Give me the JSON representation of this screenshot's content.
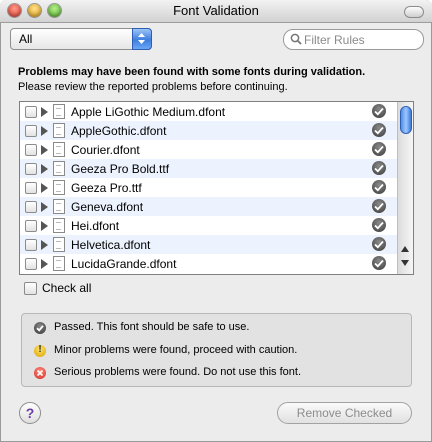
{
  "window": {
    "title": "Font Validation"
  },
  "filter": {
    "selected": "All"
  },
  "search": {
    "placeholder": "Filter Rules"
  },
  "message": {
    "headline": "Problems may have been found with some fonts during validation.",
    "subline": "Please review the reported problems before continuing."
  },
  "fonts": [
    {
      "name": "Apple LiGothic Medium.dfont",
      "status": "passed",
      "checked": false
    },
    {
      "name": "AppleGothic.dfont",
      "status": "passed",
      "checked": false
    },
    {
      "name": "Courier.dfont",
      "status": "passed",
      "checked": false
    },
    {
      "name": "Geeza Pro Bold.ttf",
      "status": "passed",
      "checked": false
    },
    {
      "name": "Geeza Pro.ttf",
      "status": "passed",
      "checked": false
    },
    {
      "name": "Geneva.dfont",
      "status": "passed",
      "checked": false
    },
    {
      "name": "Hei.dfont",
      "status": "passed",
      "checked": false
    },
    {
      "name": "Helvetica.dfont",
      "status": "passed",
      "checked": false
    },
    {
      "name": "LucidaGrande.dfont",
      "status": "passed",
      "checked": false
    }
  ],
  "check_all": {
    "label": "Check all",
    "checked": false
  },
  "legend": {
    "passed": "Passed. This font should be safe to use.",
    "minor": "Minor problems were found, proceed with caution.",
    "serious": "Serious problems were found. Do not use this font."
  },
  "buttons": {
    "help": "?",
    "remove_checked": "Remove Checked"
  },
  "colors": {
    "accent": "#3d7edf",
    "alt_row": "#edf3fe",
    "warning": "#d9a200",
    "error": "#d22a1e"
  },
  "icons": {
    "passed": "checkmark-circle-icon",
    "minor": "exclamation-yellow-icon",
    "serious": "x-red-icon",
    "font_file": "document-icon",
    "disclosure": "disclosure-triangle-icon"
  }
}
